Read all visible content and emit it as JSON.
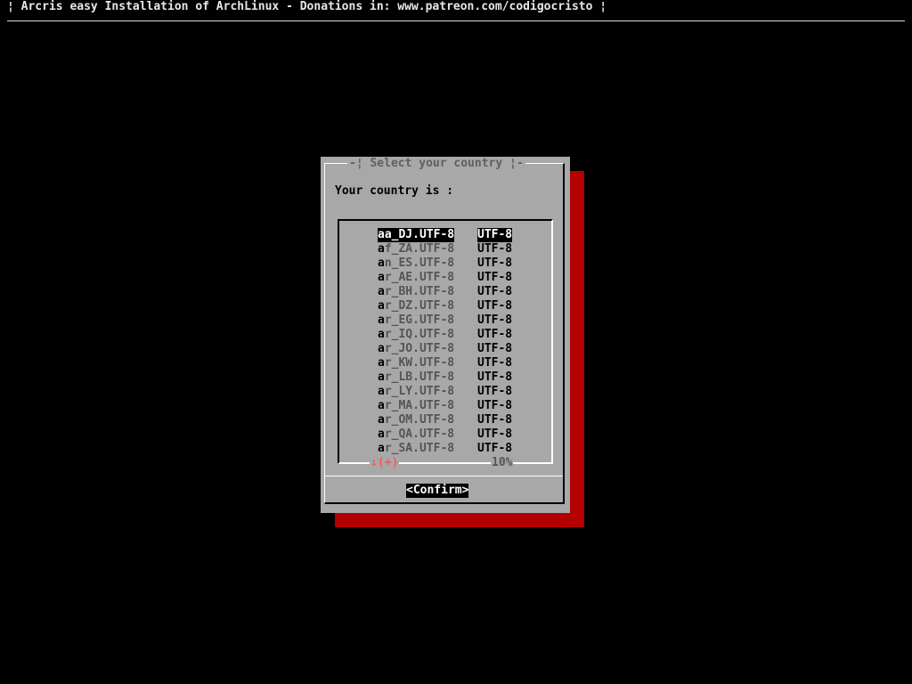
{
  "backtitle": "¦ Arcris easy Installation of ArchLinux - Donations in: www.patreon.com/codigocristo ¦",
  "dialog": {
    "title": "-¦ Select your country ¦-",
    "prompt": "Your country is :",
    "items": [
      {
        "tag": "aa_DJ.UTF-8",
        "item": "UTF-8",
        "selected": true
      },
      {
        "tag": "af_ZA.UTF-8",
        "item": "UTF-8",
        "selected": false
      },
      {
        "tag": "an_ES.UTF-8",
        "item": "UTF-8",
        "selected": false
      },
      {
        "tag": "ar_AE.UTF-8",
        "item": "UTF-8",
        "selected": false
      },
      {
        "tag": "ar_BH.UTF-8",
        "item": "UTF-8",
        "selected": false
      },
      {
        "tag": "ar_DZ.UTF-8",
        "item": "UTF-8",
        "selected": false
      },
      {
        "tag": "ar_EG.UTF-8",
        "item": "UTF-8",
        "selected": false
      },
      {
        "tag": "ar_IQ.UTF-8",
        "item": "UTF-8",
        "selected": false
      },
      {
        "tag": "ar_JO.UTF-8",
        "item": "UTF-8",
        "selected": false
      },
      {
        "tag": "ar_KW.UTF-8",
        "item": "UTF-8",
        "selected": false
      },
      {
        "tag": "ar_LB.UTF-8",
        "item": "UTF-8",
        "selected": false
      },
      {
        "tag": "ar_LY.UTF-8",
        "item": "UTF-8",
        "selected": false
      },
      {
        "tag": "ar_MA.UTF-8",
        "item": "UTF-8",
        "selected": false
      },
      {
        "tag": "ar_OM.UTF-8",
        "item": "UTF-8",
        "selected": false
      },
      {
        "tag": "ar_QA.UTF-8",
        "item": "UTF-8",
        "selected": false
      },
      {
        "tag": "ar_SA.UTF-8",
        "item": "UTF-8",
        "selected": false
      }
    ],
    "scroll_indicator": "↓(+)",
    "scroll_percent": "10%",
    "confirm_label": "<Confirm>"
  },
  "colors": {
    "screen_background": "#000000",
    "dialog_background": "#a8a8a8",
    "dialog_shadow": "#b40000",
    "selected_background": "#000000",
    "selected_text": "#ffffff",
    "scroll_indicator": "#ff5555"
  }
}
